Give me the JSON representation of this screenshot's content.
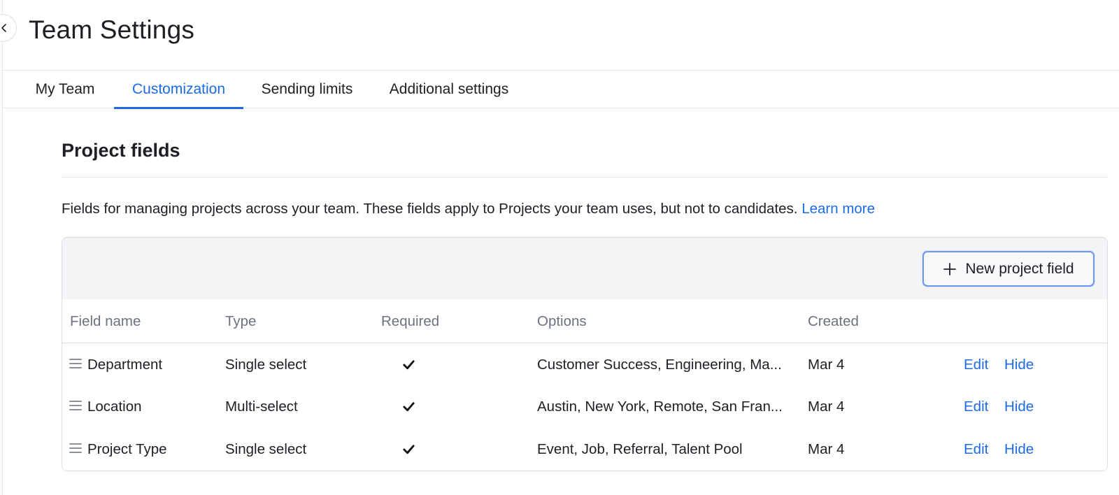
{
  "page": {
    "title": "Team Settings"
  },
  "tabs": [
    {
      "label": "My Team"
    },
    {
      "label": "Customization"
    },
    {
      "label": "Sending limits"
    },
    {
      "label": "Additional settings"
    }
  ],
  "active_tab": "Customization",
  "section": {
    "title": "Project fields",
    "description": "Fields for managing projects across your team. These fields apply to Projects your team uses, but not to candidates.",
    "learn_more": "Learn more"
  },
  "toolbar": {
    "new_field_label": "New project field"
  },
  "table": {
    "columns": [
      "Field name",
      "Type",
      "Required",
      "Options",
      "Created"
    ],
    "rows": [
      {
        "name": "Department",
        "type": "Single select",
        "required": true,
        "options": "Customer Success, Engineering, Ma...",
        "created": "Mar 4",
        "edit": "Edit",
        "hide": "Hide"
      },
      {
        "name": "Location",
        "type": "Multi-select",
        "required": true,
        "options": "Austin, New York, Remote, San Fran...",
        "created": "Mar 4",
        "edit": "Edit",
        "hide": "Hide"
      },
      {
        "name": "Project Type",
        "type": "Single select",
        "required": true,
        "options": "Event, Job, Referral, Talent Pool",
        "created": "Mar 4",
        "edit": "Edit",
        "hide": "Hide"
      }
    ]
  },
  "colors": {
    "accent": "#1d6ae5",
    "muted_text": "#6b7280",
    "toolbar_bg": "#f3f4f6",
    "border": "#d9dce1"
  },
  "icons": {
    "collapse": "chevron-left-icon",
    "add": "plus-icon",
    "drag": "drag-handle-icon",
    "required": "checkmark-icon"
  }
}
